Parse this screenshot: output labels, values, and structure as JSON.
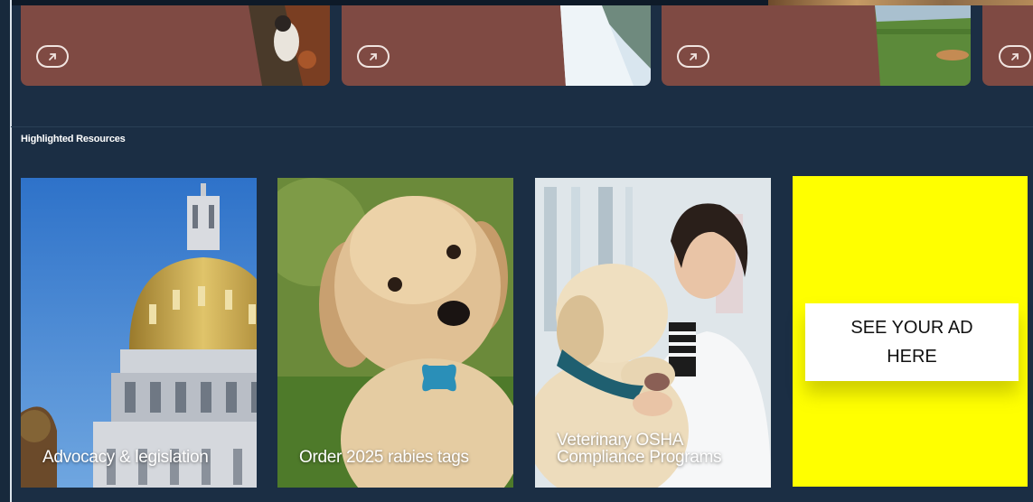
{
  "top_cards": [
    {
      "name": "featured-card-1",
      "accent": "#7f4a43"
    },
    {
      "name": "featured-card-2",
      "accent": "#7f4a43"
    },
    {
      "name": "featured-card-3",
      "accent": "#7f4a43"
    },
    {
      "name": "featured-card-4",
      "accent": "#7f4a43"
    }
  ],
  "section": {
    "title": "Highlighted Resources"
  },
  "resources": [
    {
      "label": "Advocacy & legislation"
    },
    {
      "label": "Order 2025 rabies tags"
    },
    {
      "label": "Veterinary OSHA Compliance Programs"
    }
  ],
  "ad": {
    "text": "SEE YOUR AD HERE",
    "background": "#ffff00"
  },
  "icons": {
    "card_link": "arrow-up-right-icon"
  }
}
